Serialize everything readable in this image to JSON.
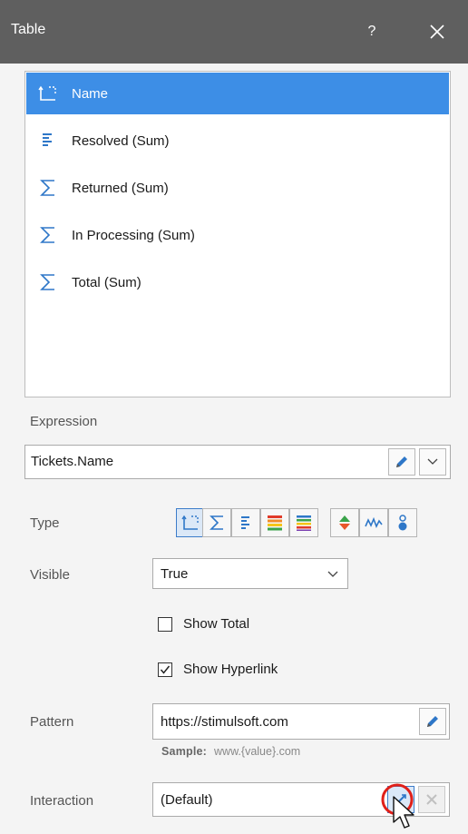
{
  "window": {
    "title": "Table",
    "help": "?"
  },
  "fields": [
    {
      "label": "Name",
      "icon": "dimension-icon",
      "selected": true
    },
    {
      "label": "Resolved (Sum)",
      "icon": "align-lines-icon",
      "selected": false
    },
    {
      "label": "Returned (Sum)",
      "icon": "sigma-icon",
      "selected": false
    },
    {
      "label": "In Processing (Sum)",
      "icon": "sigma-icon",
      "selected": false
    },
    {
      "label": "Total (Sum)",
      "icon": "sigma-icon",
      "selected": false
    }
  ],
  "expression": {
    "label": "Expression",
    "value": "Tickets.Name"
  },
  "type": {
    "label": "Type",
    "buttons": [
      "dimension-icon",
      "sigma-icon",
      "align-lines-icon",
      "color-bars-icon",
      "indicator-icon",
      "sparkline-icon",
      "bubble-icon"
    ],
    "active": 0
  },
  "visible": {
    "label": "Visible",
    "value": "True"
  },
  "show_total": {
    "label": "Show Total",
    "checked": false
  },
  "show_hyperlink": {
    "label": "Show Hyperlink",
    "checked": true
  },
  "pattern": {
    "label": "Pattern",
    "value": "https://stimulsoft.com",
    "sample_label": "Sample:",
    "sample_value": "www.{value}.com"
  },
  "interaction": {
    "label": "Interaction",
    "value": "(Default)"
  },
  "colors": {
    "titlebar": "#5f5f5f",
    "selection": "#3d8ee6",
    "accent": "#2e77c8",
    "highlight_circle": "#e0201a"
  }
}
